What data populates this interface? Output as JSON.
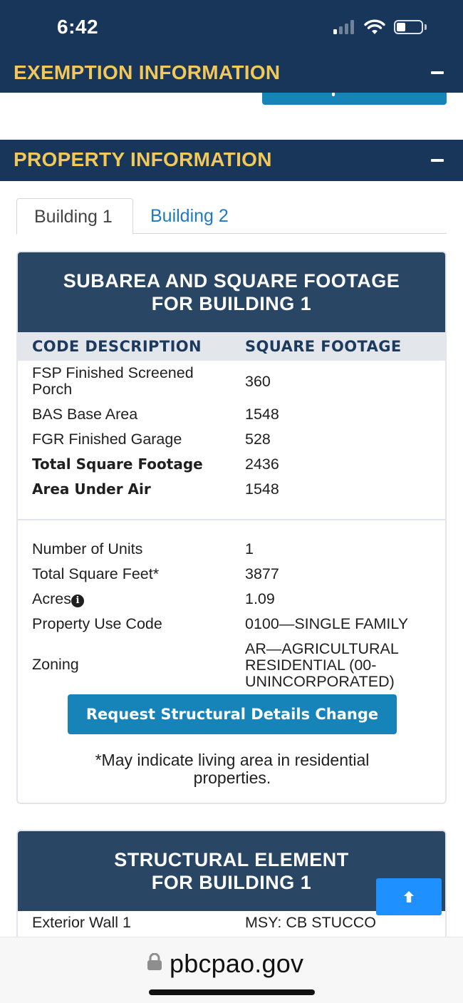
{
  "status_bar": {
    "time": "6:42"
  },
  "sections": {
    "exemption": {
      "title": "EXEMPTION INFORMATION",
      "toggle": "−"
    },
    "property": {
      "title": "PROPERTY INFORMATION",
      "toggle": "−"
    }
  },
  "tabs": [
    {
      "label": "Building 1",
      "active": true
    },
    {
      "label": "Building 2",
      "active": false
    }
  ],
  "subarea": {
    "heading_line1": "SUBAREA AND SQUARE FOOTAGE",
    "heading_line2": "FOR BUILDING 1",
    "col_code": "CODE DESCRIPTION",
    "col_sqft": "SQUARE FOOTAGE",
    "rows": [
      {
        "code": "FSP Finished Screened Porch",
        "sqft": "360"
      },
      {
        "code": "BAS Base Area",
        "sqft": "1548"
      },
      {
        "code": "FGR Finished Garage",
        "sqft": "528"
      },
      {
        "code": "Total Square Footage",
        "sqft": "2436"
      },
      {
        "code": "Area Under Air",
        "sqft": "1548"
      }
    ]
  },
  "details": {
    "rows": [
      {
        "label": "Number of Units",
        "value": "1"
      },
      {
        "label": "Total Square Feet*",
        "value": "3877"
      },
      {
        "label": "Acres",
        "value": "1.09"
      },
      {
        "label": "Property Use Code",
        "value": "0100—SINGLE FAMILY"
      },
      {
        "label": "Zoning",
        "value": "AR—AGRICULTURAL RESIDENTIAL (00-UNINCORPORATED)"
      }
    ],
    "request_button": "Request Structural Details Change",
    "footnote": "*May indicate living area in residential properties."
  },
  "structural": {
    "heading_line1": "STRUCTURAL ELEMENT",
    "heading_line2": "FOR BUILDING 1",
    "rows": [
      {
        "label": "Exterior Wall 1",
        "value": "MSY: CB STUCCO"
      }
    ]
  },
  "browser": {
    "url": "pbcpao.gov"
  },
  "colors": {
    "navy": "#17365a",
    "gold": "#f2c85a",
    "card_header": "#294665",
    "button_blue": "#1784b9",
    "scroll_top_blue": "#1e90ff"
  }
}
